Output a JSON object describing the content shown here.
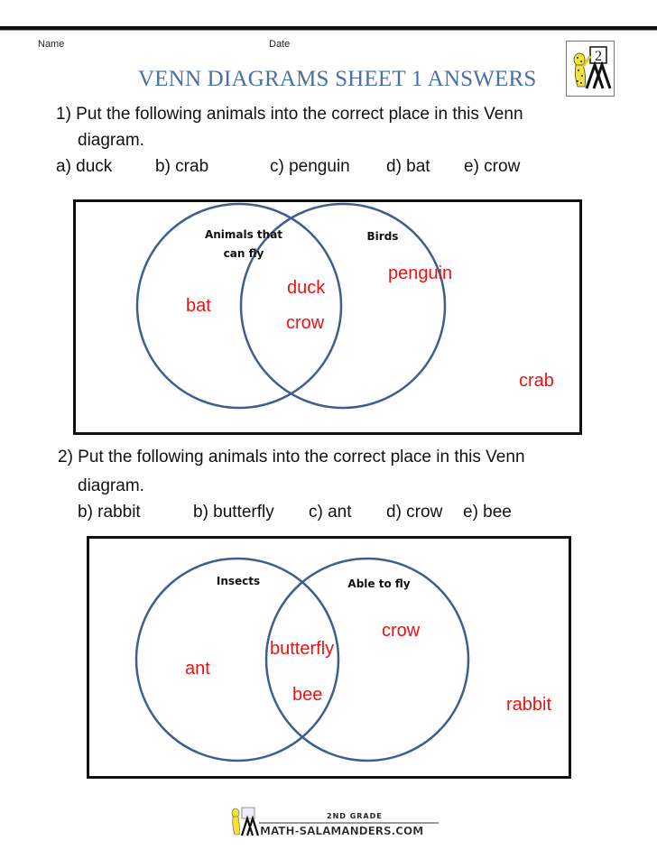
{
  "header": {
    "name_label": "Name",
    "date_label": "Date",
    "title": "VENN DIAGRAMS SHEET 1 ANSWERS",
    "logo_icon": "salamander-grade-2-logo-icon",
    "logo_number": "2"
  },
  "question1": {
    "prompt_line1": "1) Put the following animals into the correct place in this Venn",
    "prompt_line2": "diagram.",
    "options": [
      "a) duck",
      "b) crab",
      "c) penguin",
      "d) bat",
      "e) crow"
    ],
    "diagram": {
      "left_set_label_line1": "Animals that",
      "left_set_label_line2": "can fly",
      "right_set_label": "Birds",
      "left_only": [
        "bat"
      ],
      "intersection": [
        "duck",
        "crow"
      ],
      "right_only": [
        "penguin"
      ],
      "outside": [
        "crab"
      ]
    }
  },
  "question2": {
    "prompt_line1": "2) Put the following animals into the correct place in this Venn",
    "prompt_line2": "diagram.",
    "options": [
      "b) rabbit",
      "b) butterfly",
      "c) ant",
      "d) crow",
      "e) bee"
    ],
    "diagram": {
      "left_set_label": "Insects",
      "right_set_label": "Able to fly",
      "left_only": [
        "ant"
      ],
      "intersection": [
        "butterfly",
        "bee"
      ],
      "right_only": [
        "crow"
      ],
      "outside": [
        "rabbit"
      ]
    }
  },
  "footer": {
    "grade_text": "2ND GRADE",
    "site_text": "MATH-SALAMANDERS.COM",
    "logo_icon": "math-salamanders-logo-icon"
  },
  "colors": {
    "title": "#4a6fa5",
    "circle": "#3d5f8f",
    "answer": "#ee1111"
  }
}
